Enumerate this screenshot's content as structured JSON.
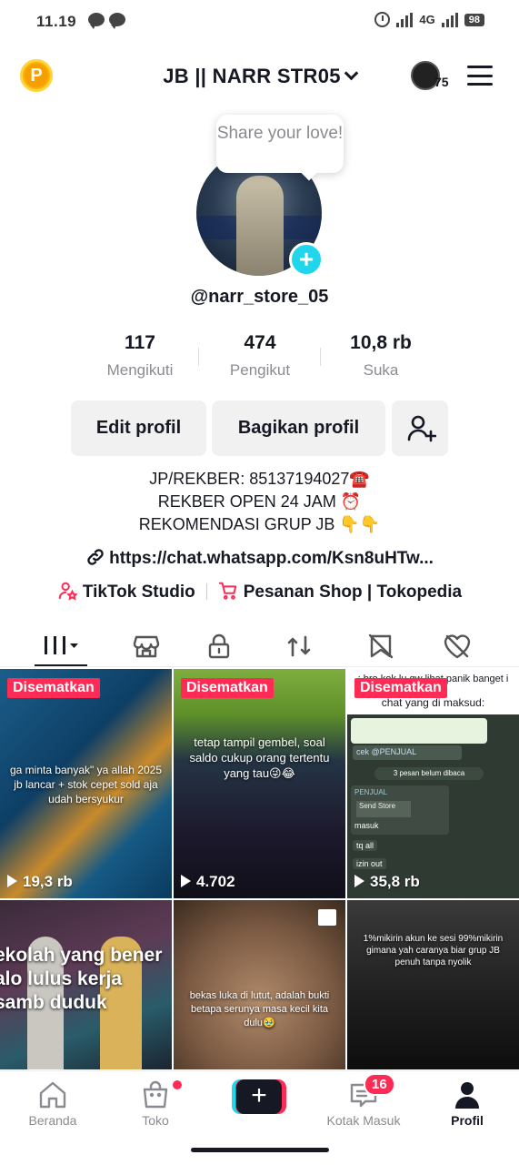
{
  "status_bar": {
    "time": "11.19",
    "network": "4G",
    "battery": "98"
  },
  "header": {
    "title": "JB || NARR STR05",
    "story_count": "75",
    "coin_label": "P"
  },
  "profile": {
    "tooltip": "Share your love!",
    "handle": "@narr_store_05",
    "stats": [
      {
        "value": "117",
        "label": "Mengikuti"
      },
      {
        "value": "474",
        "label": "Pengikut"
      },
      {
        "value": "10,8 rb",
        "label": "Suka"
      }
    ],
    "edit_label": "Edit profil",
    "share_label": "Bagikan profil",
    "bio": [
      "JP/REKBER: 85137194027☎️",
      "REKBER OPEN 24 JAM ⏰",
      "REKOMENDASI GRUP JB 👇👇"
    ],
    "link": "https://chat.whatsapp.com/Ksn8uHTw...",
    "tiktok_studio": "TikTok Studio",
    "shop_link": "Pesanan Shop | Tokopedia"
  },
  "tabs": [
    "videos-icon",
    "shop-icon",
    "private-icon",
    "repost-icon",
    "saved-icon",
    "liked-icon"
  ],
  "videos": [
    {
      "pinned": "Disematkan",
      "views": "19,3 rb",
      "caption": "ga minta banyak\" ya allah 2025 jb lancar + stok cepet sold aja udah bersyukur"
    },
    {
      "pinned": "Disematkan",
      "views": "4.702",
      "caption": "tetap tampil gembel, soal saldo cukup orang tertentu yang tau😜😂"
    },
    {
      "pinned": "Disematkan",
      "views": "35,8 rb",
      "caption_top": ": bro kok lu gw lihat panik banget i doang",
      "caption": "chat yang di maksud:",
      "chat_label": "cek @PENJUAL",
      "chat_unread": "3 pesan belum dibaca",
      "chat_sender": "PENJUAL",
      "chat_store": "Send Store",
      "chat_lines": [
        "masuk",
        "tq all",
        "izin out"
      ]
    },
    {
      "caption": "ekolah yang bener alo lulus kerja samb duduk"
    },
    {
      "caption": "bekas luka di lutut, adalah bukti betapa serunya masa kecil kita dulu🥹"
    },
    {
      "caption": "1%mikirin akun ke sesi 99%mikirin gimana yah caranya biar grup JB penuh tanpa nyolik"
    }
  ],
  "bottom_nav": {
    "home": "Beranda",
    "shop": "Toko",
    "inbox": "Kotak Masuk",
    "inbox_badge": "16",
    "profile": "Profil"
  },
  "colors": {
    "accent": "#fe2c55",
    "cyan": "#20d5ec",
    "text": "#161823"
  }
}
